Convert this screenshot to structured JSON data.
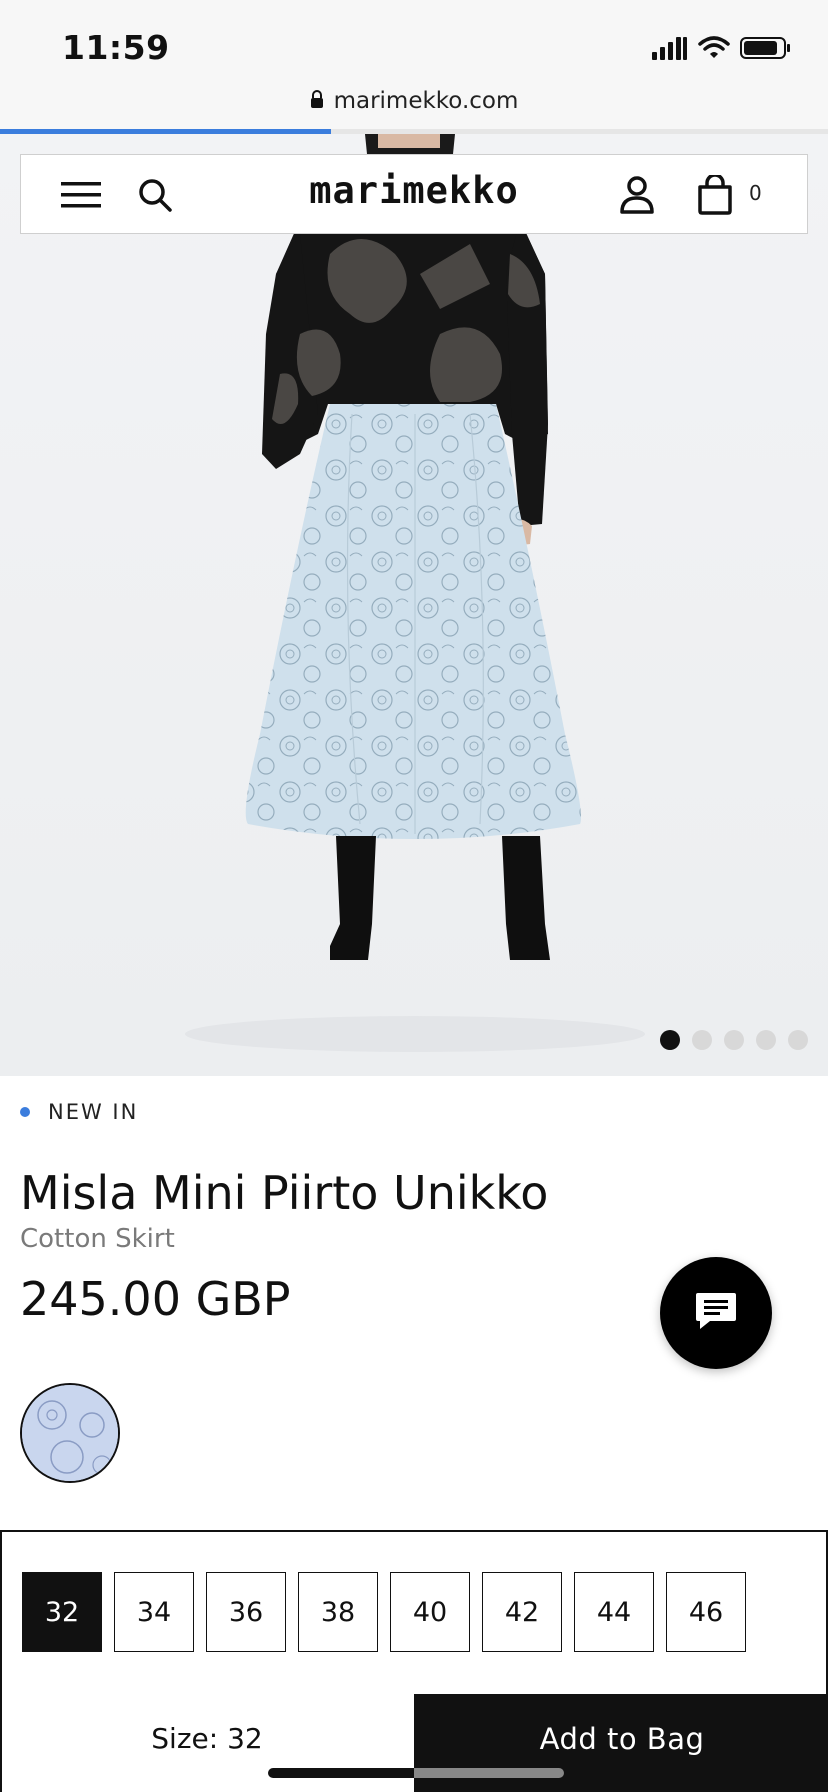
{
  "status_bar": {
    "time": "11:59",
    "icons": [
      "signal-icon",
      "wifi-icon",
      "battery-icon"
    ]
  },
  "browser": {
    "url": "marimekko.com",
    "lock_icon": "lock-icon",
    "load_progress": 0.4
  },
  "header": {
    "logo": "marimekko",
    "cart_count": "0",
    "icons": [
      "menu-icon",
      "search-icon",
      "account-icon",
      "bag-icon"
    ]
  },
  "gallery": {
    "image_count": 5,
    "active_index": 0
  },
  "product": {
    "badge": "NEW IN",
    "badge_color": "#3b7ddd",
    "name": "Misla Mini Piirto Unikko",
    "type": "Cotton Skirt",
    "price": "245.00 GBP"
  },
  "sizes": {
    "options": [
      "32",
      "34",
      "36",
      "38",
      "40",
      "42",
      "44",
      "46"
    ],
    "selected": "32",
    "selected_label": "Size: 32"
  },
  "actions": {
    "add_to_bag": "Add to Bag"
  }
}
